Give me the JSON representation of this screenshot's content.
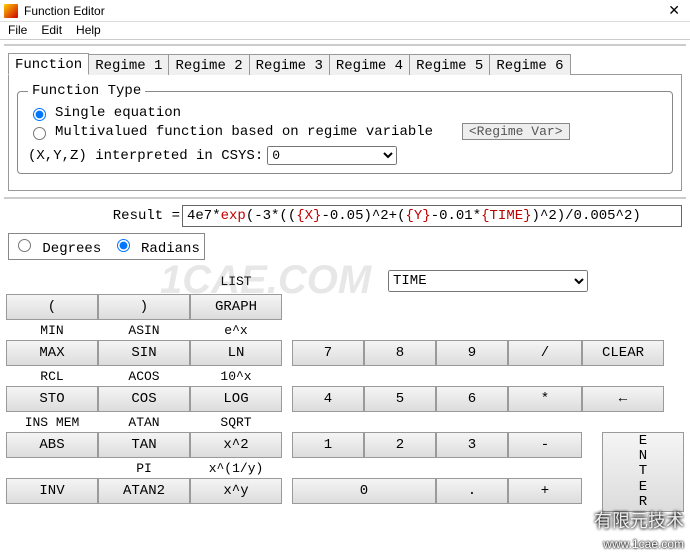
{
  "window": {
    "title": "Function Editor"
  },
  "menu": {
    "file": "File",
    "edit": "Edit",
    "help": "Help"
  },
  "tabs": {
    "active": 0,
    "items": [
      "Function",
      "Regime 1",
      "Regime 2",
      "Regime 3",
      "Regime 4",
      "Regime 5",
      "Regime 6"
    ]
  },
  "ftype": {
    "legend": "Function Type",
    "opt_single": "Single equation",
    "opt_multi": "Multivalued function based on regime variable",
    "regime_var_placeholder": "<Regime Var>",
    "selected": "single",
    "csys_label": "(X,Y,Z) interpreted in CSYS:",
    "csys_value": "0"
  },
  "result": {
    "label": "Result =",
    "prefix": "4e7*",
    "fn": "exp",
    "mid1": "(-3*((",
    "varX": "{X}",
    "mid2": "-0.05)^2+(",
    "varY": "{Y}",
    "mid3": "-0.01*",
    "varT": "{TIME}",
    "suffix": ")^2)/0.005^2)"
  },
  "mode": {
    "degrees": "Degrees",
    "radians": "Radians",
    "selected": "radians"
  },
  "variable_dropdown": "TIME",
  "labels": {
    "list": "LIST",
    "min": "MIN",
    "asin": "ASIN",
    "ex": "e^x",
    "rcl": "RCL",
    "acos": "ACOS",
    "tenx": "10^x",
    "insmem": "INS MEM",
    "atan": "ATAN",
    "sqrt": "SQRT",
    "pi": "PI",
    "xiy": "x^(1/y)"
  },
  "buttons": {
    "lparen": "(",
    "rparen": ")",
    "graph": "GRAPH",
    "max": "MAX",
    "sin": "SIN",
    "ln": "LN",
    "sto": "STO",
    "cos": "COS",
    "log": "LOG",
    "abs": "ABS",
    "tan": "TAN",
    "x2": "x^2",
    "inv": "INV",
    "atan2": "ATAN2",
    "xy": "x^y",
    "n7": "7",
    "n8": "8",
    "n9": "9",
    "div": "/",
    "clear": "CLEAR",
    "n4": "4",
    "n5": "5",
    "n6": "6",
    "mul": "*",
    "back": "←",
    "n1": "1",
    "n2": "2",
    "n3": "3",
    "sub": "-",
    "enter": "E\nN\nT\nE\nR",
    "n0": "0",
    "dot": ".",
    "add": "+"
  },
  "watermarks": {
    "w1": "1CAE.COM",
    "w2": "有限元技术",
    "w3": "www.1cae.com"
  }
}
